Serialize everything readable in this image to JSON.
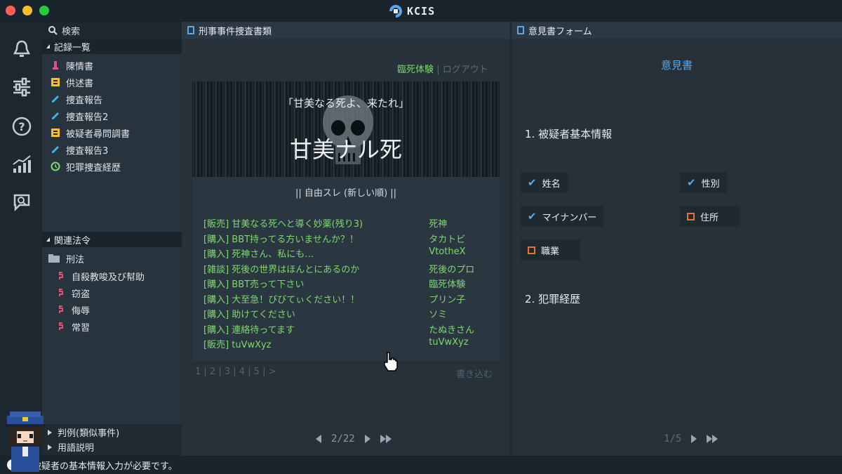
{
  "app": {
    "title": "KCIS"
  },
  "rail": {
    "icons": [
      "bell-icon",
      "sliders-icon",
      "help-icon",
      "chart-icon",
      "chat-search-icon"
    ]
  },
  "sidebar": {
    "search_label": "検索",
    "records_title": "記録一覧",
    "records": [
      {
        "label": "陳情書",
        "icon": "pen-icon"
      },
      {
        "label": "供述書",
        "icon": "note-icon"
      },
      {
        "label": "捜査報告",
        "icon": "pencil-icon"
      },
      {
        "label": "捜査報告2",
        "icon": "pencil-icon"
      },
      {
        "label": "被疑者尋問調書",
        "icon": "note-icon"
      },
      {
        "label": "捜査報告3",
        "icon": "pencil-icon"
      },
      {
        "label": "犯罪捜査経歴",
        "icon": "history-icon"
      }
    ],
    "laws_title": "関連法令",
    "law_folder": "刑法",
    "laws": [
      "自殺教唆及び幇助",
      "窃盗",
      "侮辱",
      "常習"
    ],
    "collapsed": [
      "判例(類似事件)",
      "用語説明"
    ]
  },
  "middle": {
    "header": "刑事事件捜査書類",
    "user_link": "臨死体験",
    "logout": "ログアウト",
    "banner_quote": "「甘美なる死よ、来たれ」",
    "banner_title": "甘美ナル死",
    "board_header": "|| 自由スレ (新しい順) ||",
    "threads": [
      {
        "subject": "[販売] 甘美なる死へと導く妙薬(残り3)",
        "author": "死神"
      },
      {
        "subject": "[購入] BBT持ってる方いませんか？！",
        "author": "タカトビ"
      },
      {
        "subject": "[購入] 死神さん、私にも…",
        "author": "VtotheX"
      },
      {
        "subject": "[雑談] 死後の世界はほんとにあるのか",
        "author": "死後のプロ"
      },
      {
        "subject": "[購入] BBT売って下さい",
        "author": "臨死体験"
      },
      {
        "subject": "[購入] 大至急！びびてぃください！！",
        "author": "プリン子"
      },
      {
        "subject": "[購入] 助けてください",
        "author": "ソミ"
      },
      {
        "subject": "[購入] 連絡待ってます",
        "author": "たぬきさん"
      },
      {
        "subject": "[販売] tuVwXyz",
        "author": "tuVwXyz"
      }
    ],
    "pager": "1 | 2 | 3 | 4 | 5 | >",
    "write": "書き込む",
    "page_indicator": "2/22"
  },
  "right": {
    "header": "意見書フォーム",
    "form_title": "意見書",
    "section1": "1. 被疑者基本情報",
    "fields": [
      {
        "label": "姓名",
        "checked": true
      },
      {
        "label": "性別",
        "checked": true
      },
      {
        "label": "マイナンバー",
        "checked": true
      },
      {
        "label": "住所",
        "checked": false
      },
      {
        "label": "職業",
        "checked": false
      }
    ],
    "section2": "2. 犯罪経歴",
    "page_indicator": "1/5"
  },
  "status": {
    "message": "被疑者の基本情報入力が必要です。"
  },
  "colors": {
    "accent_blue": "#5aa8e8",
    "link_green": "#7fd86f",
    "unchecked_orange": "#f07030"
  }
}
